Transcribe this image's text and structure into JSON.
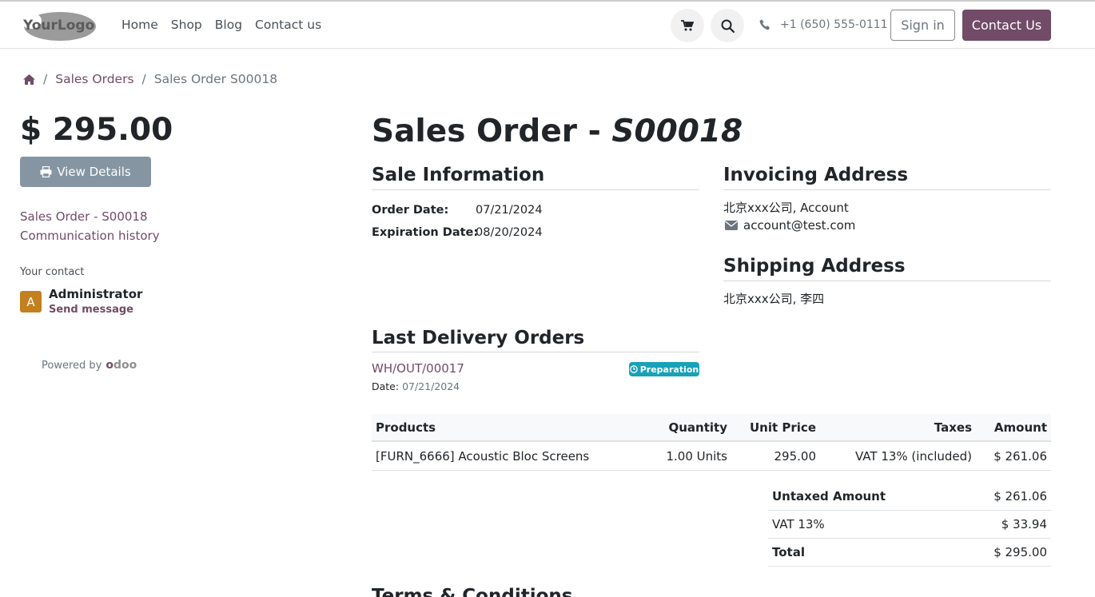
{
  "header": {
    "logo_text": "YourLogo",
    "nav": [
      "Home",
      "Shop",
      "Blog",
      "Contact us"
    ],
    "phone": "+1 (650) 555-0111",
    "signin_label": "Sign in",
    "contact_label": "Contact Us"
  },
  "breadcrumb": {
    "items": [
      "Sales Orders",
      "Sales Order S00018"
    ]
  },
  "sidebar": {
    "amount": "$ 295.00",
    "view_details_label": "View Details",
    "links": [
      "Sales Order - S00018",
      "Communication history"
    ],
    "your_contact_label": "Your contact",
    "contact_initial": "A",
    "contact_name": "Administrator",
    "send_message_label": "Send message",
    "powered_by": "Powered by",
    "powered_brand": "odoo"
  },
  "order": {
    "title_prefix": "Sales Order - ",
    "title_ref": "S00018",
    "sale_info_title": "Sale Information",
    "order_date_label": "Order Date:",
    "order_date": "07/21/2024",
    "expiration_date_label": "Expiration Date:",
    "expiration_date": "08/20/2024",
    "invoicing_title": "Invoicing Address",
    "invoicing_name": "北京xxx公司, Account",
    "invoicing_email": "account@test.com",
    "shipping_title": "Shipping Address",
    "shipping_name": "北京xxx公司, 李四",
    "delivery_title": "Last Delivery Orders",
    "delivery_ref": "WH/OUT/00017",
    "delivery_status": "Preparation",
    "delivery_date_label": "Date:",
    "delivery_date": "07/21/2024"
  },
  "table": {
    "headers": [
      "Products",
      "Quantity",
      "Unit Price",
      "Taxes",
      "Amount"
    ],
    "rows": [
      [
        "[FURN_6666] Acoustic Bloc Screens",
        "1.00 Units",
        "295.00",
        "VAT 13% (included)",
        "$ 261.06"
      ]
    ]
  },
  "totals": {
    "untaxed_label": "Untaxed Amount",
    "untaxed_value": "$ 261.06",
    "vat_label": "VAT 13%",
    "vat_value": "$ 33.94",
    "total_label": "Total",
    "total_value": "$ 295.00"
  },
  "terms_title": "Terms & Conditions",
  "colors": {
    "brand": "#714B67",
    "view_button": "#8595a2",
    "badge": "#17a2b8",
    "avatar": "#c2801f"
  },
  "icons": [
    "cart-icon",
    "search-icon",
    "phone-icon",
    "home-icon",
    "print-icon",
    "envelope-icon",
    "clock-icon"
  ]
}
